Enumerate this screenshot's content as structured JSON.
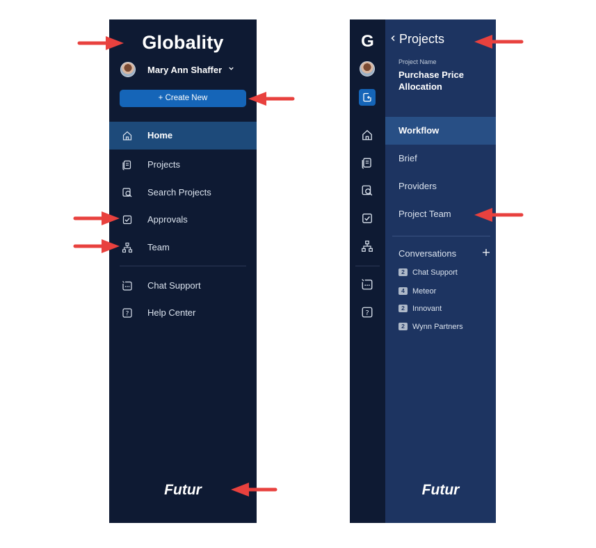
{
  "left_panel": {
    "logo": "Globality",
    "user_name": "Mary Ann Shaffer",
    "create_button": "+ Create New",
    "nav_items": [
      {
        "label": "Home",
        "icon": "home-icon",
        "active": true
      },
      {
        "label": "Projects",
        "icon": "projects-icon"
      },
      {
        "label": "Search Projects",
        "icon": "search-projects-icon"
      },
      {
        "label": "Approvals",
        "icon": "approvals-icon"
      },
      {
        "label": "Team",
        "icon": "team-icon"
      }
    ],
    "support_items": [
      {
        "label": "Chat Support",
        "icon": "chat-support-icon"
      },
      {
        "label": "Help Center",
        "icon": "help-center-icon"
      }
    ],
    "brand": "Futur"
  },
  "right_panel": {
    "rail_logo": "G",
    "title": "Projects",
    "project_name_label": "Project Name",
    "project_name": "Purchase Price Allocation",
    "nav_items": [
      {
        "label": "Workflow",
        "active": true
      },
      {
        "label": "Brief"
      },
      {
        "label": "Providers"
      },
      {
        "label": "Project Team"
      }
    ],
    "conversations_label": "Conversations",
    "conversations": [
      {
        "count": "2",
        "name": "Chat Support"
      },
      {
        "count": "4",
        "name": "Meteor"
      },
      {
        "count": "2",
        "name": "Innovant"
      },
      {
        "count": "2",
        "name": "Wynn Partners"
      }
    ],
    "brand": "Futur"
  },
  "colors": {
    "sidebar_bg": "#0e1a33",
    "panel_bg": "#1d3461",
    "accent": "#1565b8",
    "arrow": "#e8413e"
  }
}
